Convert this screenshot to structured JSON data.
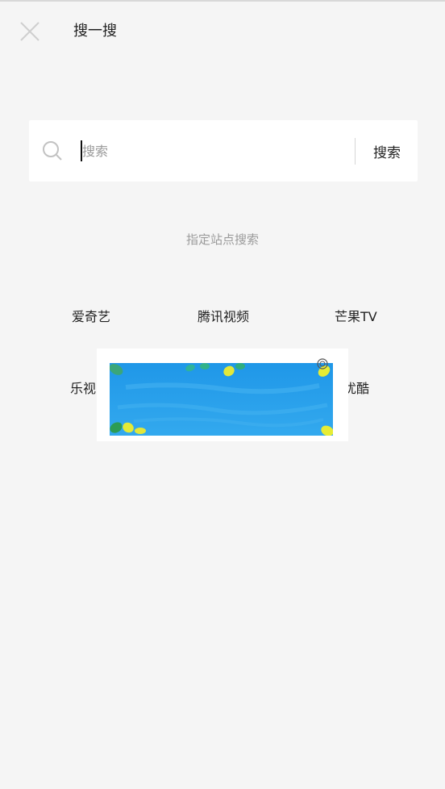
{
  "header": {
    "title": "搜一搜",
    "close_icon": "close-icon"
  },
  "search": {
    "placeholder": "搜索",
    "value": "",
    "button_label": "搜索",
    "icon": "search-icon"
  },
  "sites": {
    "section_label": "指定站点搜索",
    "items": [
      {
        "label": "爱奇艺"
      },
      {
        "label": "腾讯视频"
      },
      {
        "label": "芒果TV"
      },
      {
        "label": "乐视"
      },
      {
        "label": "优酷"
      }
    ]
  },
  "ad": {
    "background_color": "#2aa3ec",
    "mark_icon": "ad-mark-icon"
  },
  "colors": {
    "page_background": "#f5f5f5",
    "card_background": "#ffffff",
    "hint_text": "#9b9b9b",
    "divider": "#d6d6d6"
  }
}
